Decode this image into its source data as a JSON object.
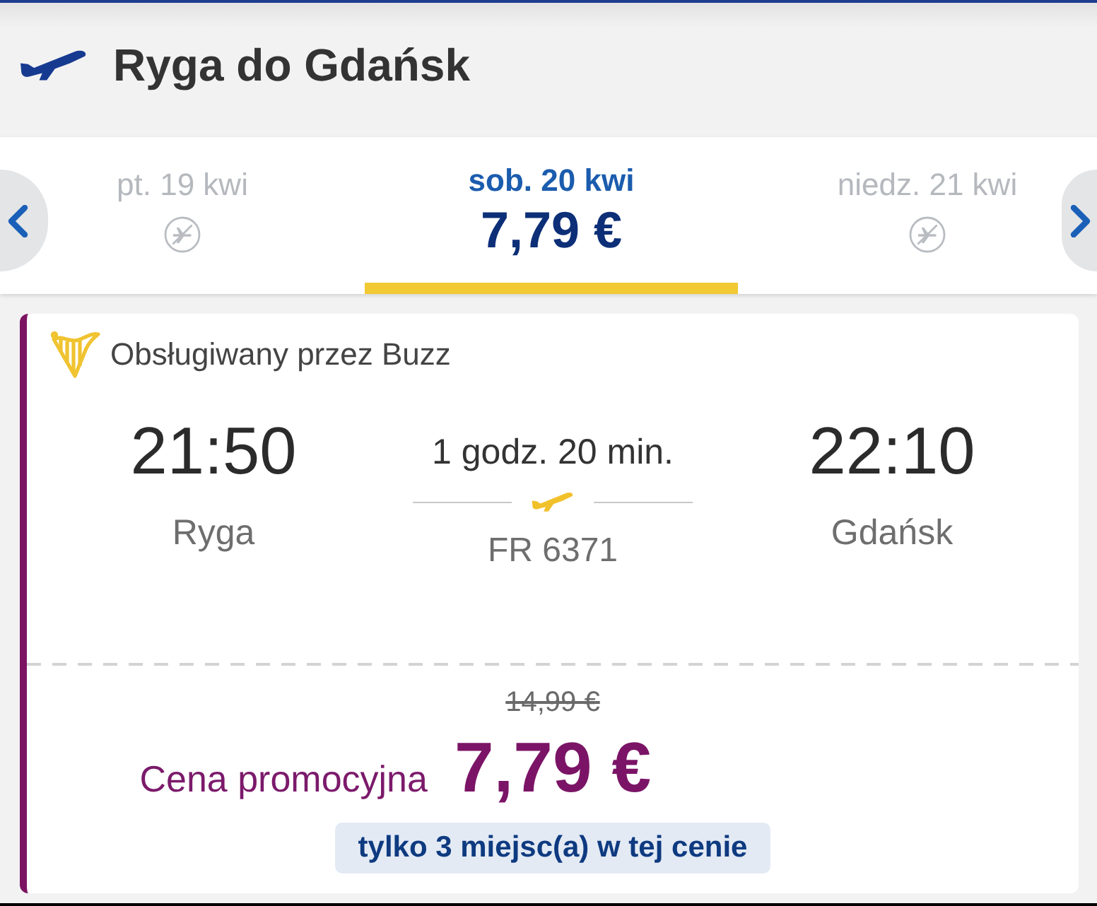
{
  "header": {
    "title": "Ryga do Gdańsk"
  },
  "date_tabs": [
    {
      "date": "pt. 19 kwi",
      "no_flights": true,
      "selected": false
    },
    {
      "date": "sob. 20 kwi",
      "price": "7,79 €",
      "no_flights": false,
      "selected": true
    },
    {
      "date": "niedz. 21 kwi",
      "no_flights": true,
      "selected": false
    }
  ],
  "flight": {
    "operator": "Obsługiwany przez Buzz",
    "departure": {
      "time": "21:50",
      "city": "Ryga"
    },
    "duration": "1 godz. 20 min.",
    "flight_number": "FR 6371",
    "arrival": {
      "time": "22:10",
      "city": "Gdańsk"
    }
  },
  "fare": {
    "original_price": "14,99 €",
    "label": "Cena promocyjna",
    "price": "7,79 €",
    "availability": "tylko 3 miejsc(a) w tej cenie"
  }
}
